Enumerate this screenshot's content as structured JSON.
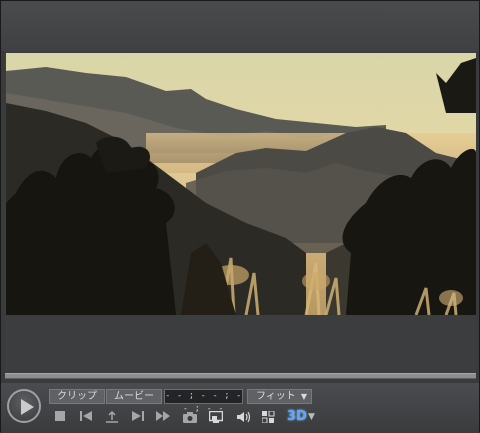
{
  "toolbar": {
    "clip_tab": "クリップ",
    "movie_tab": "ムービー",
    "timecode": "- - ; - - ; - - ; - -",
    "fit_label": "フィット",
    "fit_arrow": "▼",
    "three_d_label": "3D",
    "three_d_arrow": "▼"
  },
  "icons": [
    "stop-icon",
    "previous-frame-icon",
    "step-back-icon",
    "next-frame-icon",
    "fast-forward-icon",
    "snapshot-camera-icon",
    "external-display-icon",
    "volume-icon",
    "settings-icon",
    "3d-mode-icon"
  ],
  "colors": {
    "accent_3d": "#5aa9ff",
    "background": "#3a3b3c",
    "pill": "#5f6164"
  }
}
